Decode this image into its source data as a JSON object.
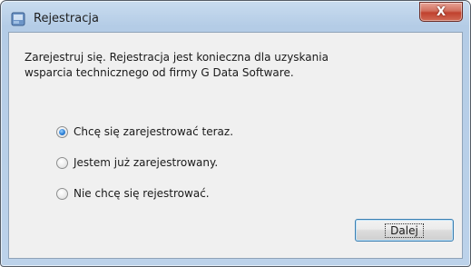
{
  "window": {
    "title": "Rejestracja",
    "close_label": "X"
  },
  "info_lines": [
    "Zarejestruj się. Rejestracja jest konieczna dla uzyskania",
    "wsparcia technicznego od firmy G Data Software."
  ],
  "options": [
    {
      "label": "Chcę się zarejestrować teraz.",
      "checked": true
    },
    {
      "label": "Jestem już zarejestrowany.",
      "checked": false
    },
    {
      "label": "Nie chcę się rejestrować.",
      "checked": false
    }
  ],
  "buttons": {
    "next_label": "Dalej"
  },
  "colors": {
    "accent": "#2b7fd6",
    "close": "#c0412e"
  }
}
